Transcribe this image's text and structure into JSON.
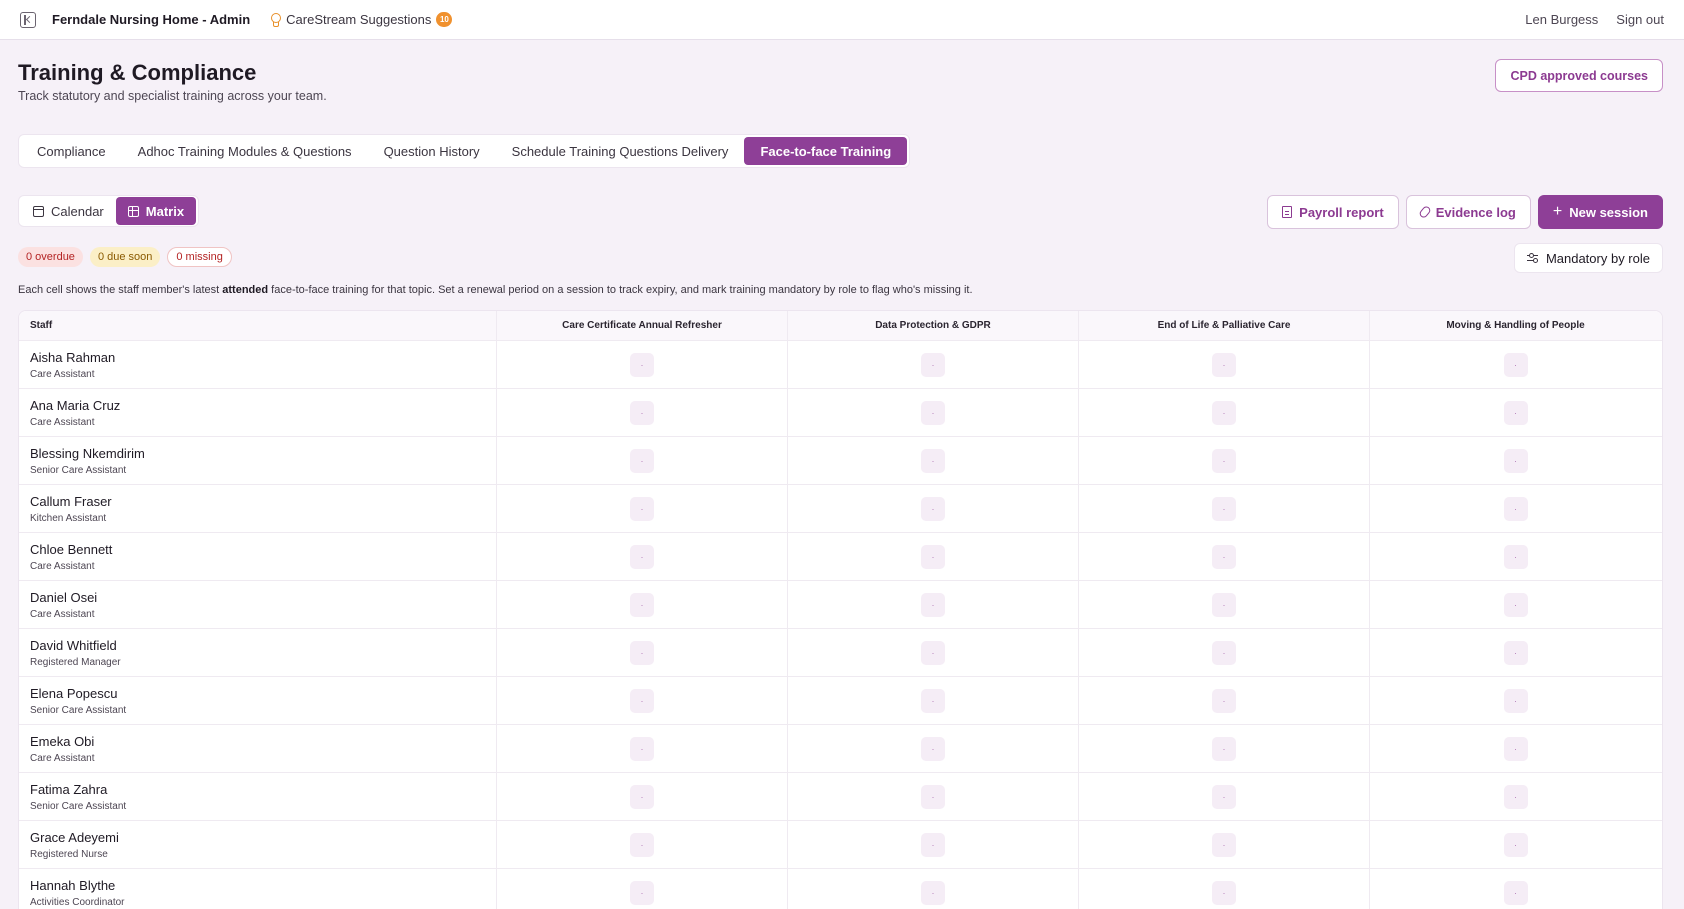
{
  "topbar": {
    "app_title": "Ferndale Nursing Home - Admin",
    "suggestions_label": "CareStream Suggestions",
    "suggestions_count": "10",
    "user_name": "Len Burgess",
    "sign_out": "Sign out"
  },
  "page": {
    "title": "Training & Compliance",
    "subtitle": "Track statutory and specialist training across your team.",
    "cpd_button": "CPD approved courses"
  },
  "tabs": [
    {
      "label": "Compliance",
      "active": false
    },
    {
      "label": "Adhoc Training Modules & Questions",
      "active": false
    },
    {
      "label": "Question History",
      "active": false
    },
    {
      "label": "Schedule Training Questions Delivery",
      "active": false
    },
    {
      "label": "Face-to-face Training",
      "active": true
    }
  ],
  "view_toggle": {
    "calendar": "Calendar",
    "matrix": "Matrix",
    "active": "matrix"
  },
  "actions": {
    "payroll": "Payroll report",
    "evidence": "Evidence log",
    "new_session": "New session"
  },
  "status_badges": {
    "overdue": "0 overdue",
    "due_soon": "0 due soon",
    "missing": "0 missing"
  },
  "mandatory_button": "Mandatory by role",
  "help": {
    "before": "Each cell shows the staff member's latest ",
    "bold": "attended",
    "after": " face-to-face training for that topic. Set a renewal period on a session to track expiry, and mark training mandatory by role to flag who's missing it."
  },
  "matrix": {
    "staff_header": "Staff",
    "cell_placeholder": "·",
    "topics": [
      "Care Certificate Annual Refresher",
      "Data Protection & GDPR",
      "End of Life & Palliative Care",
      "Moving & Handling of People"
    ],
    "staff": [
      {
        "name": "Aisha Rahman",
        "role": "Care Assistant"
      },
      {
        "name": "Ana Maria Cruz",
        "role": "Care Assistant"
      },
      {
        "name": "Blessing Nkemdirim",
        "role": "Senior Care Assistant"
      },
      {
        "name": "Callum Fraser",
        "role": "Kitchen Assistant"
      },
      {
        "name": "Chloe Bennett",
        "role": "Care Assistant"
      },
      {
        "name": "Daniel Osei",
        "role": "Care Assistant"
      },
      {
        "name": "David Whitfield",
        "role": "Registered Manager"
      },
      {
        "name": "Elena Popescu",
        "role": "Senior Care Assistant"
      },
      {
        "name": "Emeka Obi",
        "role": "Care Assistant"
      },
      {
        "name": "Fatima Zahra",
        "role": "Senior Care Assistant"
      },
      {
        "name": "Grace Adeyemi",
        "role": "Registered Nurse"
      },
      {
        "name": "Hannah Blythe",
        "role": "Activities Coordinator"
      }
    ]
  },
  "colors": {
    "accent": "#8e3f97",
    "background": "#f6f1f8",
    "badge_orange": "#f0912e"
  }
}
